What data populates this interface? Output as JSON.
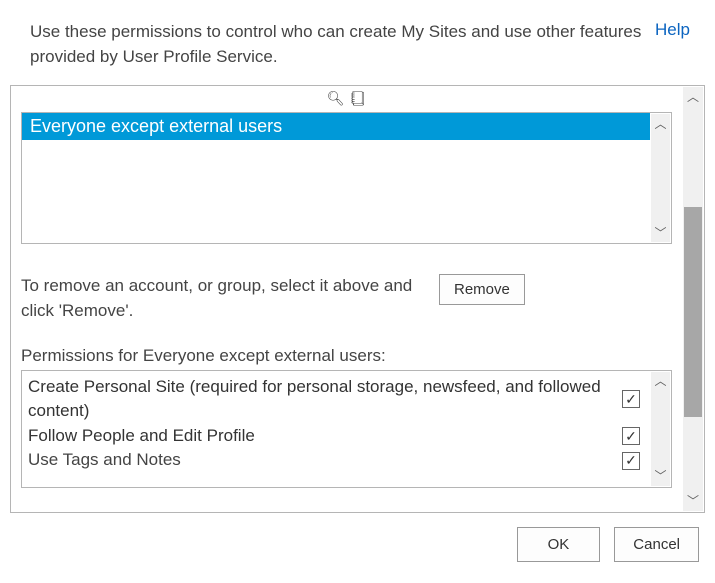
{
  "header": {
    "intro": "Use these permissions to control who can create My Sites and use other features provided by User Profile Service.",
    "help_label": "Help"
  },
  "accounts": {
    "items": [
      {
        "name": "Everyone except external users",
        "selected": true
      }
    ],
    "remove_instruction": "To remove an account, or group, select it above and click 'Remove'.",
    "remove_button_label": "Remove"
  },
  "permissions": {
    "label_prefix": "Permissions for ",
    "target": "Everyone except external users",
    "label_suffix": ":",
    "items": [
      {
        "label": "Create Personal Site (required for personal storage, newsfeed, and followed content)",
        "checked": true
      },
      {
        "label": "Follow People and Edit Profile",
        "checked": true
      },
      {
        "label": "Use Tags and Notes",
        "checked": true
      }
    ]
  },
  "footer": {
    "ok_label": "OK",
    "cancel_label": "Cancel"
  },
  "glyphs": {
    "chev_up": "︿",
    "chev_down": "﹀",
    "check": "✓"
  }
}
